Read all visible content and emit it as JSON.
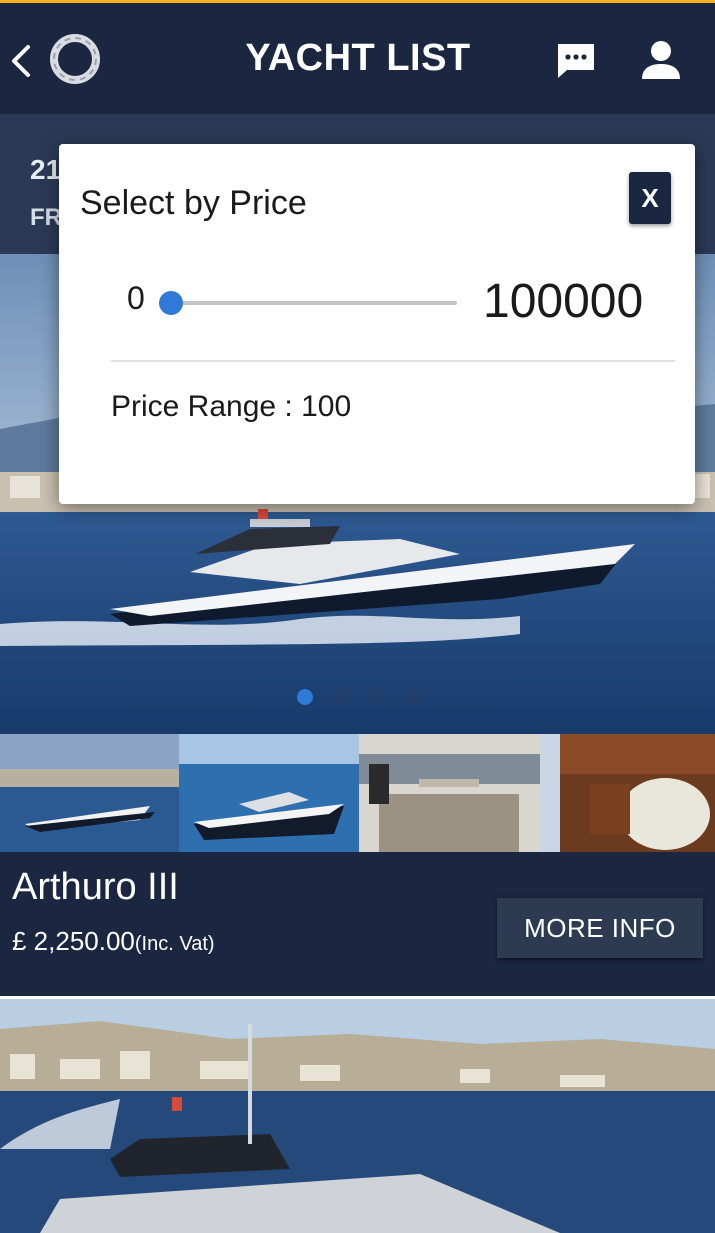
{
  "header": {
    "title": "YACHT LIST",
    "icons": [
      "back-arrow-icon",
      "logo-ring-icon",
      "chat-icon",
      "user-icon"
    ]
  },
  "subheader": {
    "line1": "21",
    "line2": "FR"
  },
  "dialog": {
    "title": "Select by Price",
    "close_label": "X",
    "slider": {
      "min_label": "0",
      "max_label": "100000",
      "value_fraction": 0.0
    },
    "range_text": "Price Range : 100"
  },
  "yacht": {
    "name": "Arthuro III",
    "price": "£ 2,250.00",
    "vat_note": "(Inc. Vat)",
    "more_info_label": "MORE INFO",
    "carousel_active_index": 0,
    "carousel_count": 4
  },
  "colors": {
    "navy": "#1b2640",
    "accent_top": "#f5b21a",
    "slider_blue": "#2f7ad6",
    "button_bg": "#2d3b52"
  }
}
